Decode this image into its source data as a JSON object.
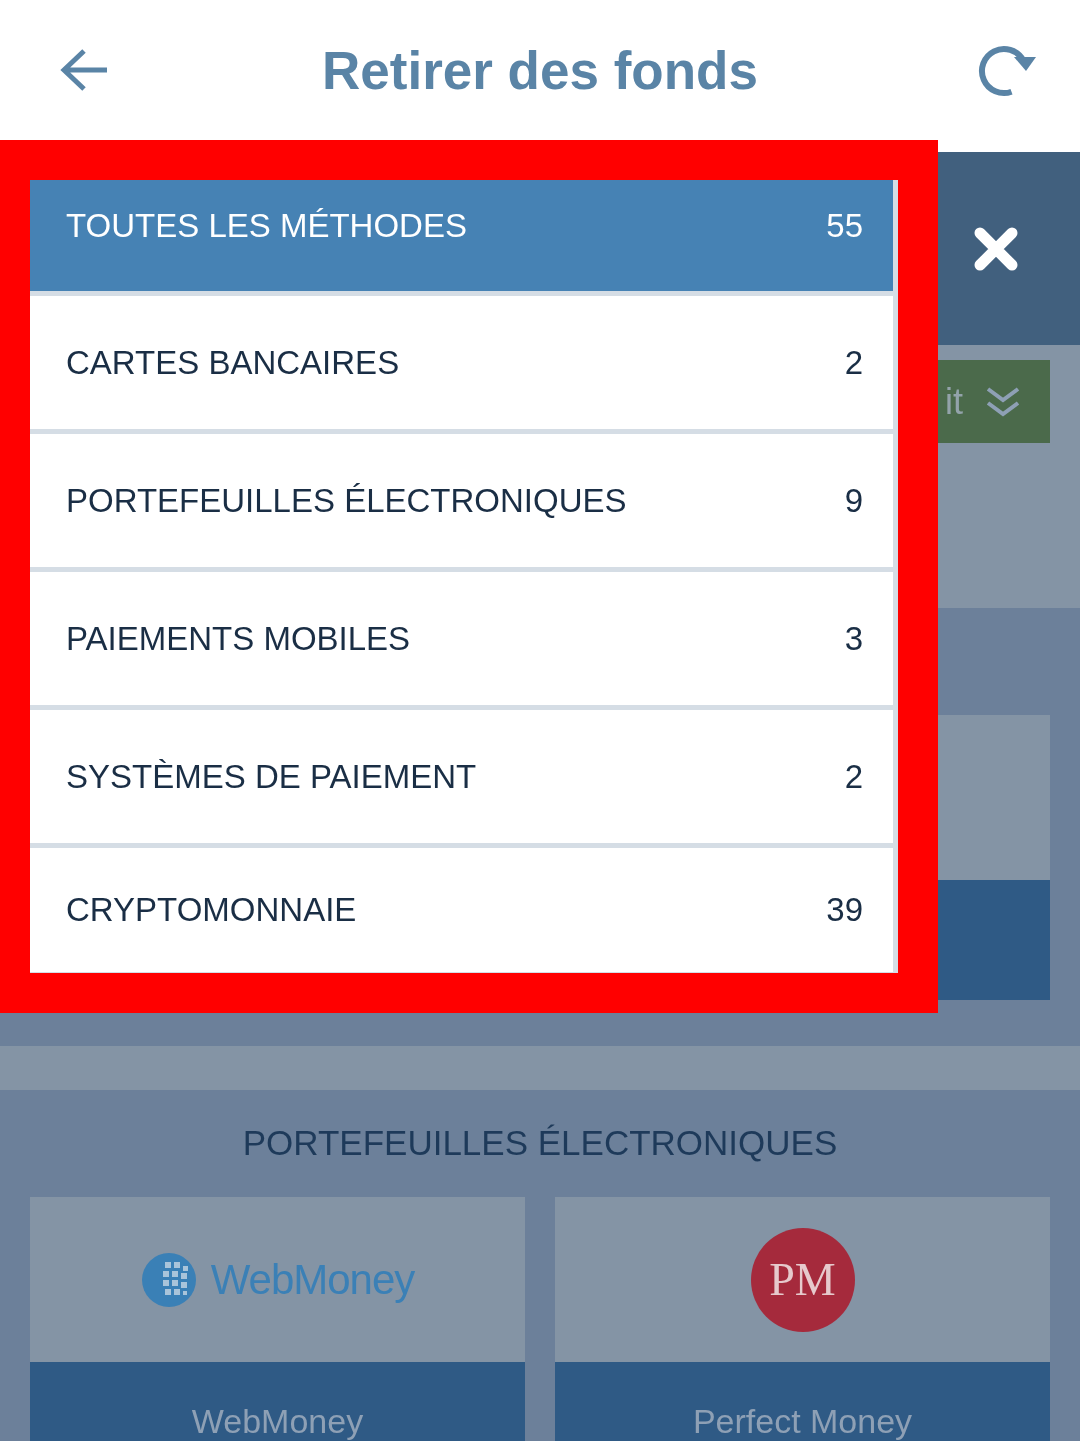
{
  "header": {
    "title": "Retirer des fonds"
  },
  "action_button": {
    "label": "it"
  },
  "category_menu": {
    "items": [
      {
        "label": "TOUTES LES MÉTHODES",
        "count": "55",
        "selected": true
      },
      {
        "label": "CARTES BANCAIRES",
        "count": "2",
        "selected": false
      },
      {
        "label": "PORTEFEUILLES ÉLECTRONIQUES",
        "count": "9",
        "selected": false
      },
      {
        "label": "PAIEMENTS MOBILES",
        "count": "3",
        "selected": false
      },
      {
        "label": "SYSTÈMES DE PAIEMENT",
        "count": "2",
        "selected": false
      },
      {
        "label": "CRYPTOMONNAIE",
        "count": "39",
        "selected": false
      }
    ]
  },
  "section": {
    "title": "PORTEFEUILLES ÉLECTRONIQUES",
    "methods": [
      {
        "kind": "globe",
        "logo_text": "WebMoney",
        "name": "WebMoney"
      },
      {
        "kind": "disc",
        "logo_text": "PM",
        "name": "Perfect Money"
      }
    ]
  }
}
